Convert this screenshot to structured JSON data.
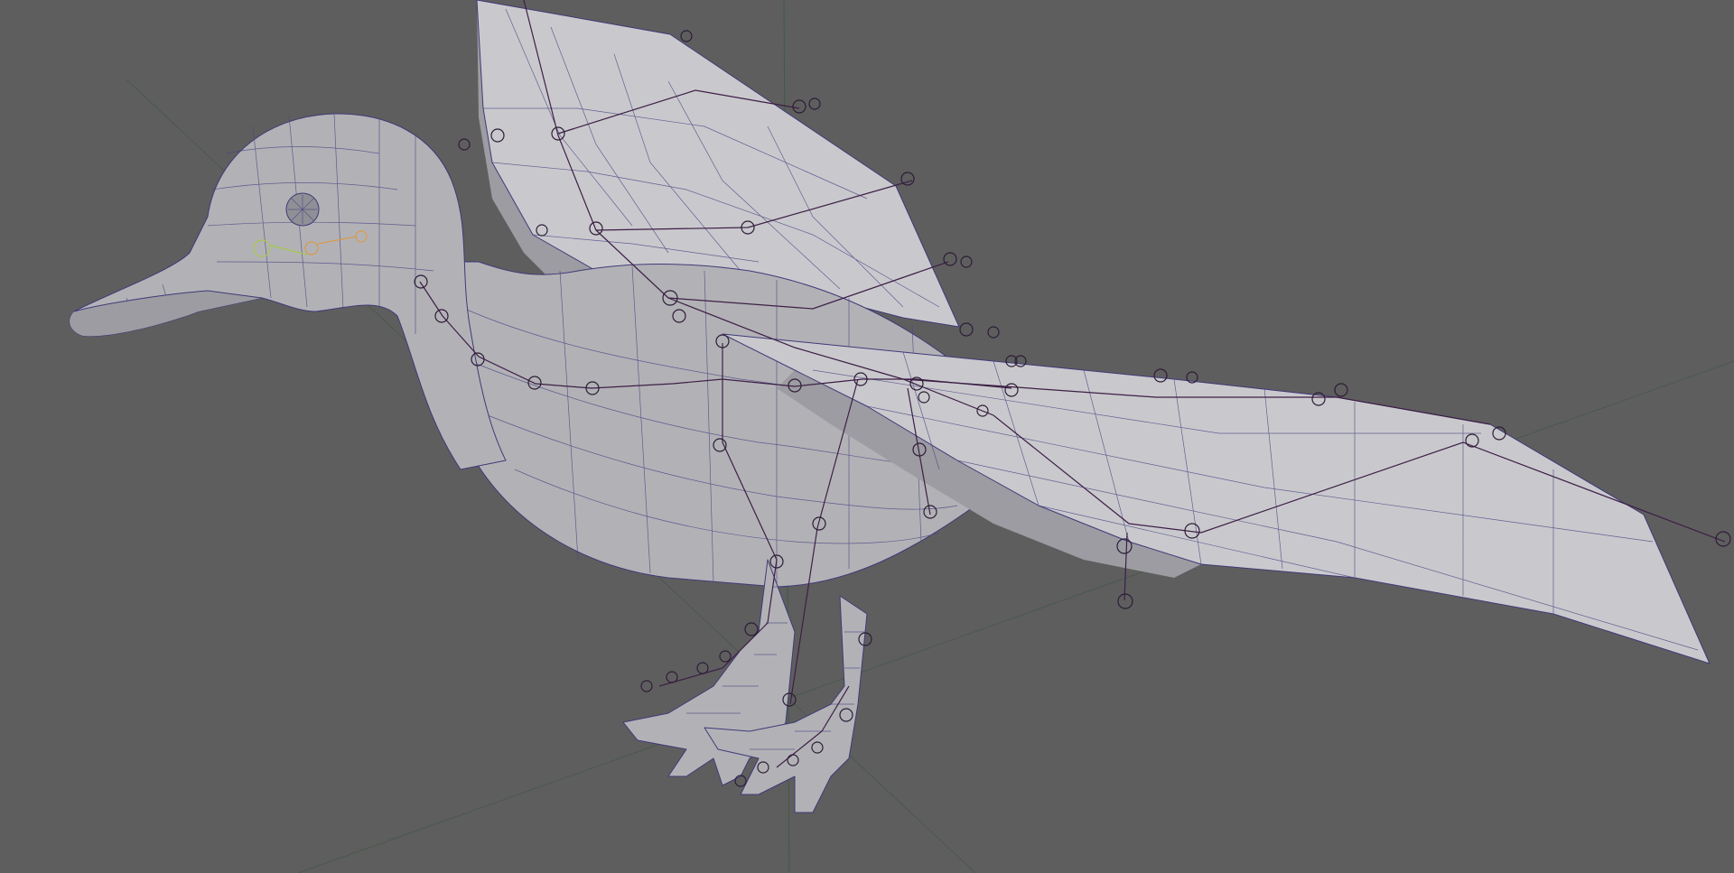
{
  "viewport": {
    "background_color": "#5e5e5e",
    "mesh_color": "#b2b2b6",
    "wireframe_color": "#3f3a78",
    "joint_color": "#2e1c36",
    "grid_color": "#46584a",
    "object": "rigged-bird-mesh"
  }
}
